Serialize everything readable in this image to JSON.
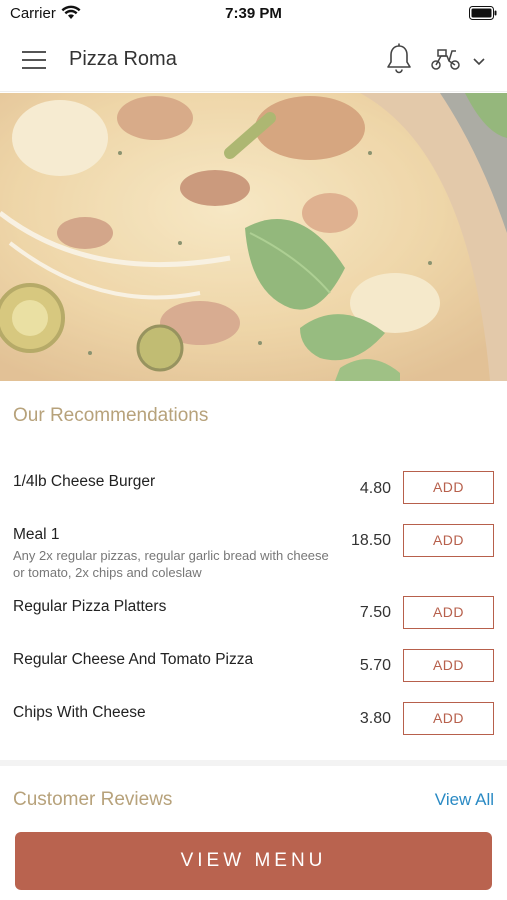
{
  "status_bar": {
    "carrier": "Carrier",
    "time": "7:39 PM"
  },
  "nav": {
    "title": "Pizza Roma"
  },
  "recommendations": {
    "title": "Our Recommendations",
    "add_label": "ADD",
    "items": [
      {
        "name": "1/4lb Cheese Burger",
        "description": "",
        "price": "4.80"
      },
      {
        "name": "Meal 1",
        "description": "Any 2x regular pizzas, regular garlic bread with cheese or tomato, 2x chips and coleslaw",
        "price": "18.50"
      },
      {
        "name": "Regular Pizza Platters",
        "description": "",
        "price": "7.50"
      },
      {
        "name": "Regular Cheese And Tomato Pizza",
        "description": "",
        "price": "5.70"
      },
      {
        "name": "Chips With Cheese",
        "description": "",
        "price": "3.80"
      }
    ]
  },
  "reviews": {
    "title": "Customer Reviews",
    "view_all": "View All"
  },
  "view_menu_label": "VIEW MENU",
  "colors": {
    "accent": "#b9634f",
    "section_title": "#b7a27b",
    "link": "#2a8ac4"
  }
}
